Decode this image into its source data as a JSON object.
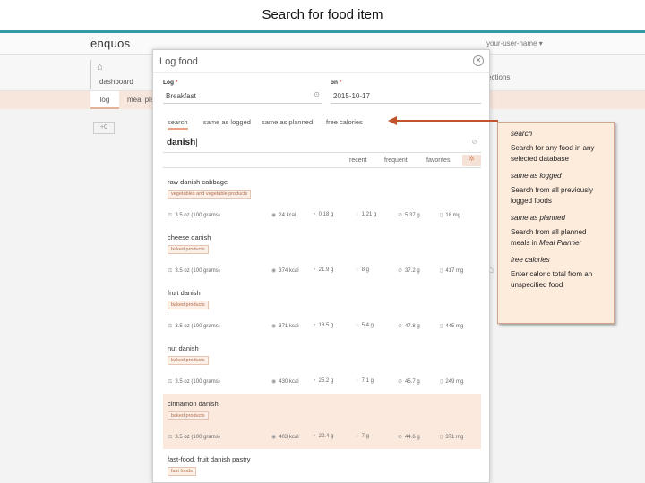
{
  "slide_title": "Search for food item",
  "app": {
    "logo": "enquos",
    "user": "your-user-name ▾",
    "nav_dashboard": "dashboard",
    "nav_sections": "sections",
    "subtab_log": "log",
    "subtab_meal": "meal plan",
    "small_button": "+0"
  },
  "modal": {
    "title": "Log food",
    "log_label": "Log",
    "log_value": "Breakfast",
    "on_label": "on",
    "on_value": "2015-10-17",
    "required_mark": "*",
    "tabs": [
      "search",
      "same as logged",
      "same as planned",
      "free calories"
    ],
    "search_value": "danish",
    "filters": [
      "recent",
      "frequent",
      "favorites"
    ],
    "items": [
      {
        "name": "raw danish cabbage",
        "category": "vegetables and vegetable products",
        "serving": "3.5 oz (100 grams)",
        "kcal": "24 kcal",
        "fat": "0.18 g",
        "protein": "1.21 g",
        "carbs": "5.37 g",
        "sodium": "18 mg"
      },
      {
        "name": "cheese danish",
        "category": "baked products",
        "serving": "3.5 oz (100 grams)",
        "kcal": "374 kcal",
        "fat": "21.9 g",
        "protein": "8 g",
        "carbs": "37.2 g",
        "sodium": "417 mg"
      },
      {
        "name": "fruit danish",
        "category": "baked products",
        "serving": "3.5 oz (100 grams)",
        "kcal": "371 kcal",
        "fat": "18.5 g",
        "protein": "5.4 g",
        "carbs": "47.8 g",
        "sodium": "445 mg"
      },
      {
        "name": "nut danish",
        "category": "baked products",
        "serving": "3.5 oz (100 grams)",
        "kcal": "430 kcal",
        "fat": "25.2 g",
        "protein": "7.1 g",
        "carbs": "45.7 g",
        "sodium": "249 mg"
      },
      {
        "name": "cinnamon danish",
        "category": "baked products",
        "serving": "3.5 oz (100 grams)",
        "kcal": "403 kcal",
        "fat": "22.4 g",
        "protein": "7 g",
        "carbs": "44.6 g",
        "sodium": "371 mg"
      },
      {
        "name": "fast-food, fruit danish pastry",
        "category": "fast foods"
      }
    ]
  },
  "callout": {
    "search_head": "search",
    "search_text": "Search for any food in any selected database",
    "logged_head": "same as logged",
    "logged_text": "Search from all previously logged foods",
    "planned_head": "same as planned",
    "planned_text_a": "Search from all planned meals in ",
    "planned_text_b": "Meal Planner",
    "free_head": "free calories",
    "free_text": "Enter caloric total from an unspecified food"
  },
  "colors": {
    "accent": "#e7a585",
    "arrow": "#c1542d",
    "callout_bg": "#fdebdc",
    "highlight_row": "#fbe9de",
    "header_bar": "#2f9ca8"
  }
}
